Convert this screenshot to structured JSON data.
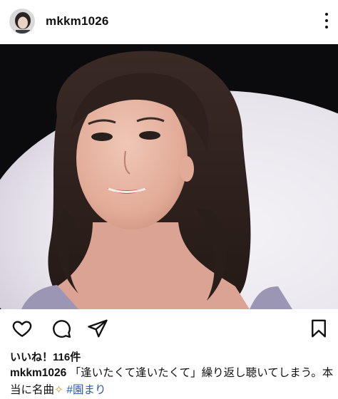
{
  "post": {
    "username": "mkkm1026",
    "likes_text": "いいね！116件",
    "caption": {
      "username": "mkkm1026",
      "text": "「逢いたくて逢いたくて」繰り返し聴いてしまう。本当に名曲",
      "emoji": "sparkles-emoji",
      "hashtag": "#園まり"
    }
  },
  "icons": {
    "more": "more-options-icon",
    "like": "heart-icon",
    "comment": "comment-icon",
    "share": "send-icon",
    "save": "bookmark-icon"
  },
  "colors": {
    "text": "#111111",
    "hashtag": "#2e5aa8",
    "photo_background": "#0b0b0d"
  }
}
